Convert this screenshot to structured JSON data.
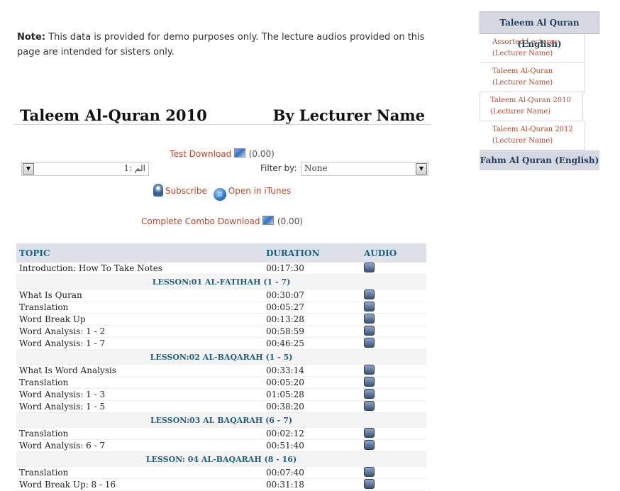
{
  "note": {
    "label": "Note:",
    "text": "This data is provided for demo purposes only. The lecture audios provided on this page are intended for sisters only."
  },
  "title": {
    "left": "Taleem Al-Quran 2010",
    "right": "By Lecturer Name"
  },
  "test_download": {
    "label": "Test Download",
    "price": "(0.00)"
  },
  "filters": {
    "surah_value": "1: الم",
    "filter_label": "Filter by:",
    "filter_value": "None"
  },
  "subscribe": {
    "subscribe_label": "Subscribe",
    "itunes_label": "Open in iTunes"
  },
  "combo_download": {
    "label": "Complete Combo Download",
    "price": "(0.00)"
  },
  "table": {
    "headers": {
      "topic": "TOPIC",
      "duration": "DURATION",
      "audio": "AUDIO"
    },
    "rows": [
      {
        "topic": "Introduction: How To Take Notes",
        "duration": "00:17:30"
      },
      {
        "lesson": "LESSON:01 AL-FATIHAH (1 - 7)"
      },
      {
        "topic": "What Is Quran",
        "duration": "00:30:07"
      },
      {
        "topic": "Translation",
        "duration": "00:05:27"
      },
      {
        "topic": "Word Break Up",
        "duration": "00:13:28"
      },
      {
        "topic": "Word Analysis: 1 - 2",
        "duration": "00:58:59"
      },
      {
        "topic": "Word Analysis: 1 - 7",
        "duration": "00:46:25"
      },
      {
        "lesson": "LESSON:02 AL-BAQARAH (1 - 5)"
      },
      {
        "topic": "What Is Word Analysis",
        "duration": "00:33:14"
      },
      {
        "topic": "Translation",
        "duration": "00:05:20"
      },
      {
        "topic": "Word Analysis: 1 - 3",
        "duration": "01:05:28"
      },
      {
        "topic": "Word Analysis: 1 - 5",
        "duration": "00:38:20"
      },
      {
        "lesson": "LESSON:03 AL BAQARAH (6 - 7)"
      },
      {
        "topic": "Translation",
        "duration": "00:02:12"
      },
      {
        "topic": "Word Analysis: 6 - 7",
        "duration": "00:51:40"
      },
      {
        "lesson": "LESSON: 04 AL-BAQARAH (8 - 16)"
      },
      {
        "topic": "Translation",
        "duration": "00:07:40"
      },
      {
        "topic": "Word Break Up: 8 - 16",
        "duration": "00:31:18"
      }
    ]
  },
  "sidebar": {
    "header": "Taleem Al Quran (English)",
    "items": [
      {
        "label": "Assorted Lectures (Lecturer Name)"
      },
      {
        "label": "Taleem Al-Quran (Lecturer Name)"
      },
      {
        "label": "Taleem Al-Quran 2010 (Lecturer Name)"
      },
      {
        "label": "Taleem Al-Quran 2012 (Lecturer Name)"
      }
    ],
    "footer": "Fahm Al Quran (English)"
  }
}
